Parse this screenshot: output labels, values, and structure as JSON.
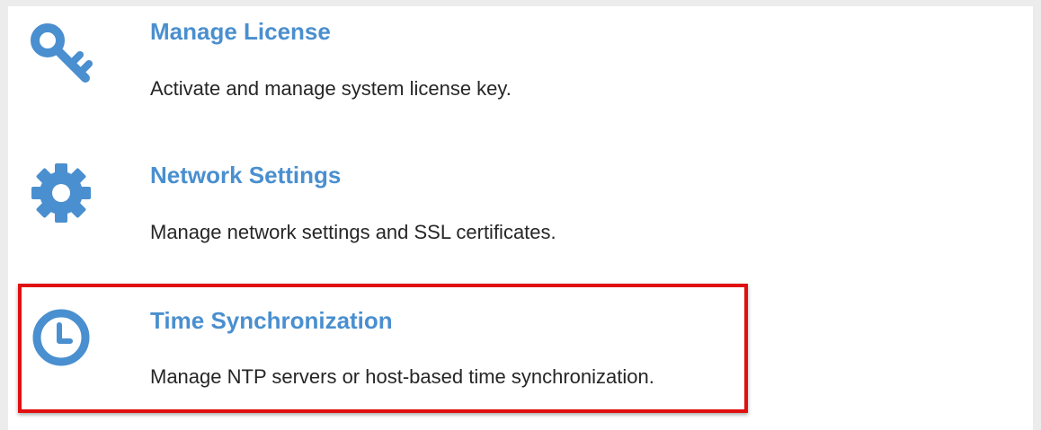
{
  "items": [
    {
      "title": "Manage License",
      "description": "Activate and manage system license key.",
      "icon": "key-icon"
    },
    {
      "title": "Network Settings",
      "description": "Manage network settings and SSL certificates.",
      "icon": "gear-icon"
    },
    {
      "title": "Time Synchronization",
      "description": "Manage NTP servers or host-based time synchronization.",
      "icon": "clock-icon"
    }
  ],
  "colors": {
    "accent": "#4a8fcf",
    "highlight_border": "#e01010",
    "text": "#262626"
  }
}
